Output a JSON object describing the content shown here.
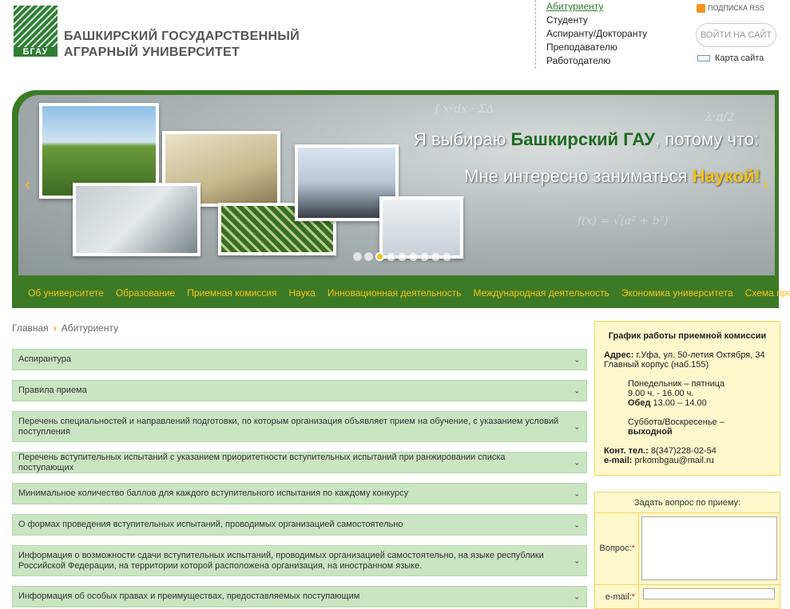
{
  "header": {
    "logo_abbr": "БГАУ",
    "univ_line1": "БАШКИРСКИЙ ГОСУДАРСТВЕННЫЙ",
    "univ_line2": "АГРАРНЫЙ УНИВЕРСИТЕТ",
    "audience": [
      "Абитуриенту",
      "Студенту",
      "Аспиранту/Докторанту",
      "Преподавателю",
      "Работодателю"
    ],
    "rss_label": "ПОДПИСКА RSS",
    "login_label": "ВОЙТИ НА САЙТ",
    "sitemap_label": "Карта сайта"
  },
  "banner": {
    "text1_pre": "Я выбираю ",
    "text1_hl": "Башкирский ГАУ",
    "text1_post": ", потому что:",
    "text2_pre": "Мне интересно заниматься ",
    "text2_hl": "Наукой!",
    "prev_arrow": "‹",
    "next_arrow": "›",
    "active_slide": 3,
    "slide_count": 9
  },
  "menu": [
    "Об университете",
    "Образование",
    "Приемная комиссия",
    "Наука",
    "Инновационная деятельность",
    "Международная деятельность",
    "Экономика университета",
    "Схема проезда"
  ],
  "breadcrumb": {
    "home": "Главная",
    "sep": "›",
    "current": "Абитуриенту"
  },
  "accordion": [
    "Аспирантура",
    "Правила приема",
    "Перечень специальностей и направлений подготовки, по которым организация объявляет прием на обучение, с указанием условий поступления",
    "Перечень вступительных испытаний с указанием приоритетности вступительных испытаний при ранжировании списка поступающих",
    "Минимальное количество баллов для каждого вступительного испытания по каждому конкурсу",
    "О формах проведения вступительных испытаний, проводимых организацией самостоятельно",
    "Информация о возможности сдачи вступительных испытаний, проводимых организацией самостоятельно, на языке республики Российской Федерации, на территории которой расположена организация, на иностранном языке.",
    "Информация об особых правах и преимуществах, предоставляемых поступающим"
  ],
  "chevron": "⌄",
  "schedule": {
    "title": "График работы приемной комиссии",
    "address_label": "Адрес:",
    "address": " г.Уфа, ул. 50-летия Октября, 34",
    "building": "Главный корпус (наб.155)",
    "weekdays": "Понедельник – пятница",
    "weekdays_hours": "9.00 ч. - 16.00 ч.",
    "lunch_label": "Обед",
    "lunch": " 13.00 – 14.00",
    "weekend": "Суббота/Воскресенье –",
    "weekend_status": "выходной",
    "phone_label": "Конт. тел.:",
    "phone": " 8(347)228-02-54",
    "email_label": "e-mail:",
    "email": " prkombgau@mail.ru"
  },
  "question_form": {
    "title": "Задать вопрос по приему:",
    "question_label": "Вопрос:",
    "email_label": "e-mail:",
    "required_mark": "*"
  }
}
